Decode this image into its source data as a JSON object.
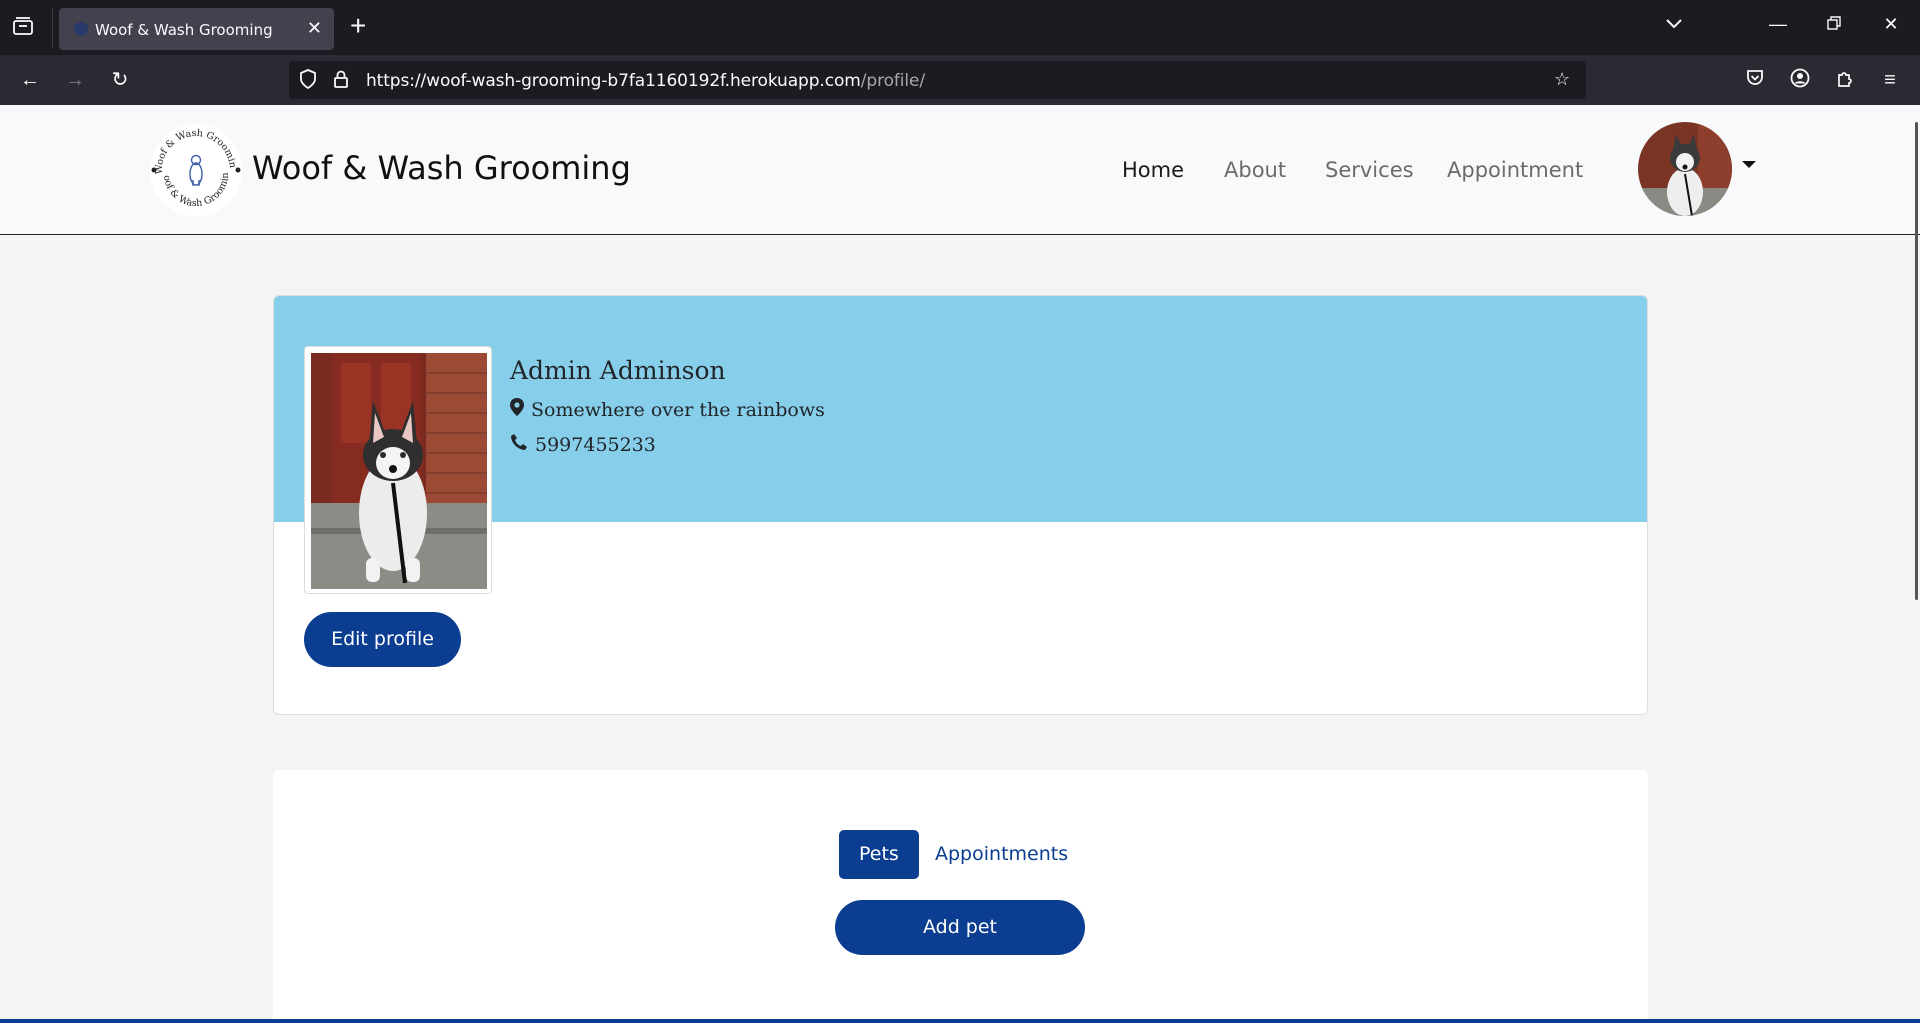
{
  "browser": {
    "tab_title": "Woof & Wash Grooming",
    "url_host": "https://woof-wash-grooming-b7fa1160192f.herokuapp.com",
    "url_path": "/profile/"
  },
  "header": {
    "brand": "Woof & Wash Grooming",
    "logo_text": "Woof & Wash Grooming",
    "nav": [
      {
        "label": "Home"
      },
      {
        "label": "About"
      },
      {
        "label": "Services"
      },
      {
        "label": "Appointment"
      }
    ]
  },
  "profile": {
    "name": "Admin Adminson",
    "location": "Somewhere over the rainbows",
    "phone": "5997455233",
    "edit_label": "Edit profile"
  },
  "tabs": {
    "items": [
      {
        "label": "Pets"
      },
      {
        "label": "Appointments"
      }
    ],
    "add_pet_label": "Add pet"
  },
  "colors": {
    "primary": "#0b3d91",
    "banner": "#87ceeb"
  }
}
